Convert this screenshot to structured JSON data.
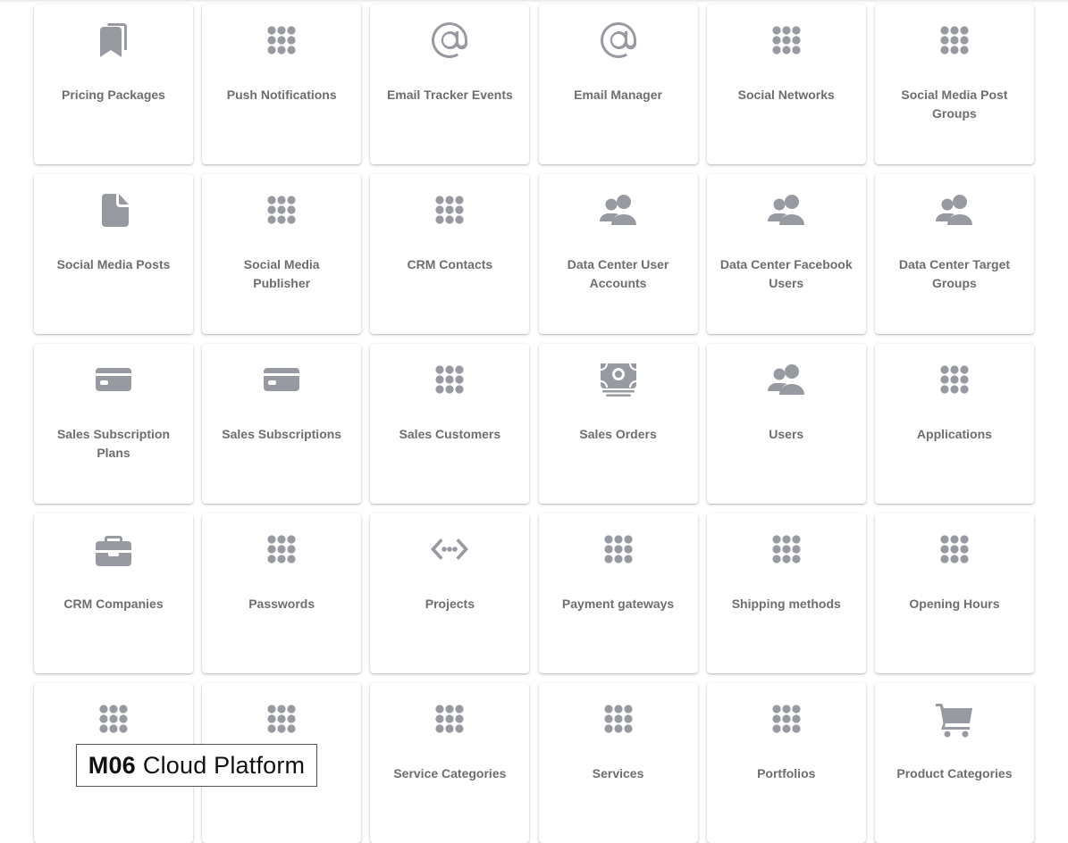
{
  "cards": [
    {
      "label": "Pricing Packages",
      "icon": "bookmarks-icon"
    },
    {
      "label": "Push Notifications",
      "icon": "apps-grid-icon"
    },
    {
      "label": "Email Tracker Events",
      "icon": "at-sign-icon"
    },
    {
      "label": "Email Manager",
      "icon": "at-sign-icon"
    },
    {
      "label": "Social Networks",
      "icon": "apps-grid-icon"
    },
    {
      "label": "Social Media Post Groups",
      "icon": "apps-grid-icon"
    },
    {
      "label": "Social Media Posts",
      "icon": "document-icon"
    },
    {
      "label": "Social Media Publisher",
      "icon": "apps-grid-icon"
    },
    {
      "label": "CRM Contacts",
      "icon": "apps-grid-icon"
    },
    {
      "label": "Data Center User Accounts",
      "icon": "people-icon"
    },
    {
      "label": "Data Center Facebook Users",
      "icon": "people-icon"
    },
    {
      "label": "Data Center Target Groups",
      "icon": "people-icon"
    },
    {
      "label": "Sales Subscription Plans",
      "icon": "credit-card-icon"
    },
    {
      "label": "Sales Subscriptions",
      "icon": "credit-card-icon"
    },
    {
      "label": "Sales Customers",
      "icon": "apps-grid-icon"
    },
    {
      "label": "Sales Orders",
      "icon": "cash-icon"
    },
    {
      "label": "Users",
      "icon": "people-icon"
    },
    {
      "label": "Applications",
      "icon": "apps-grid-icon"
    },
    {
      "label": "CRM Companies",
      "icon": "briefcase-icon"
    },
    {
      "label": "Passwords",
      "icon": "apps-grid-icon"
    },
    {
      "label": "Projects",
      "icon": "code-dots-icon"
    },
    {
      "label": "Payment gateways",
      "icon": "apps-grid-icon"
    },
    {
      "label": "Shipping methods",
      "icon": "apps-grid-icon"
    },
    {
      "label": "Opening Hours",
      "icon": "apps-grid-icon"
    },
    {
      "label": "",
      "icon": "apps-grid-icon"
    },
    {
      "label": "",
      "icon": "apps-grid-icon"
    },
    {
      "label": "Service Categories",
      "icon": "apps-grid-icon"
    },
    {
      "label": "Services",
      "icon": "apps-grid-icon"
    },
    {
      "label": "Portfolios",
      "icon": "apps-grid-icon"
    },
    {
      "label": "Product Categories",
      "icon": "cart-icon"
    }
  ],
  "watermark": {
    "brand": "M06",
    "text": "Cloud Platform"
  },
  "colors": {
    "icon": "#989aa1",
    "label": "#6e6e6e",
    "card_bg": "#ffffff"
  }
}
